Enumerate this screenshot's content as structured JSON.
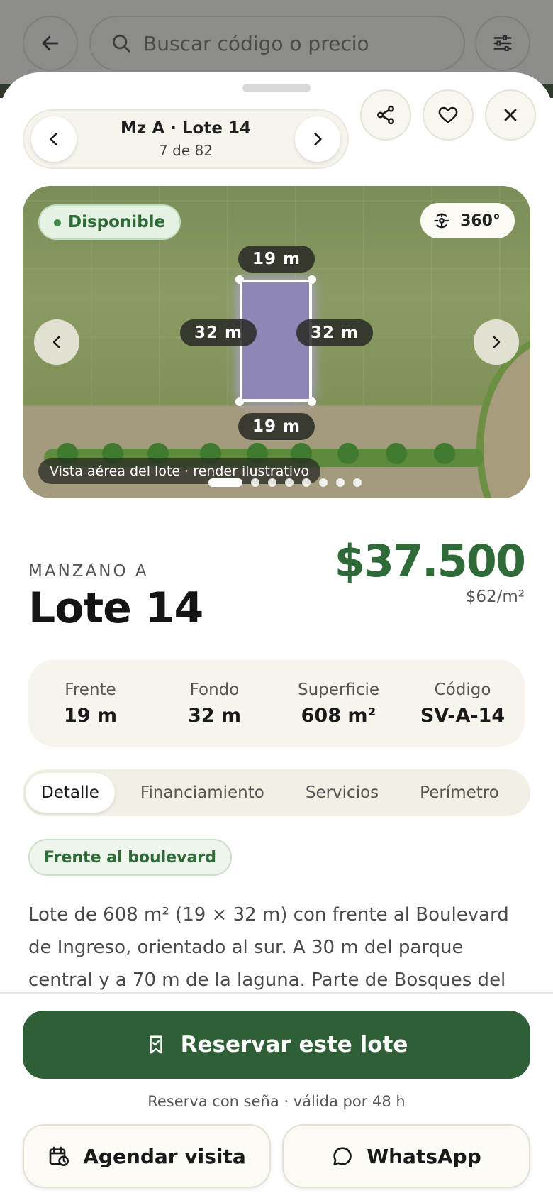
{
  "background": {
    "search_placeholder": "Buscar código o precio"
  },
  "header": {
    "title": "Mz A · Lote 14",
    "position": "7 de 82"
  },
  "gallery": {
    "status": "Disponible",
    "view_360": "360°",
    "dim_top": "19 m",
    "dim_bottom": "19 m",
    "dim_left": "32 m",
    "dim_right": "32 m",
    "caption": "Vista aérea del lote · render ilustrativo",
    "slide_count": 8,
    "active_slide": 1
  },
  "lot": {
    "block_label": "MANZANO A",
    "title": "Lote 14",
    "price": "$37.500",
    "price_per_m2": "$62/m²"
  },
  "specs": [
    {
      "label": "Frente",
      "value": "19 m"
    },
    {
      "label": "Fondo",
      "value": "32 m"
    },
    {
      "label": "Superficie",
      "value": "608 m²"
    },
    {
      "label": "Código",
      "value": "SV-A-14"
    }
  ],
  "tabs": [
    {
      "label": "Detalle",
      "active": true
    },
    {
      "label": "Financiamiento",
      "active": false
    },
    {
      "label": "Servicios",
      "active": false
    },
    {
      "label": "Perímetro",
      "active": false
    }
  ],
  "tag": "Frente al boulevard",
  "description": "Lote de 608 m² (19 × 32 m) con frente al Boulevard de Ingreso, orientado al sur. A 30 m del parque central y a 70 m de la laguna. Parte de Bosques del Urubó.",
  "actions": {
    "reserve": "Reservar este lote",
    "reserve_note": "Reserva con seña · válida por 48 h",
    "schedule": "Agendar visita",
    "whatsapp": "WhatsApp"
  },
  "colors": {
    "accent": "#2f6b38",
    "primary_button": "#2e5f36",
    "surface": "#f6f4ec"
  }
}
